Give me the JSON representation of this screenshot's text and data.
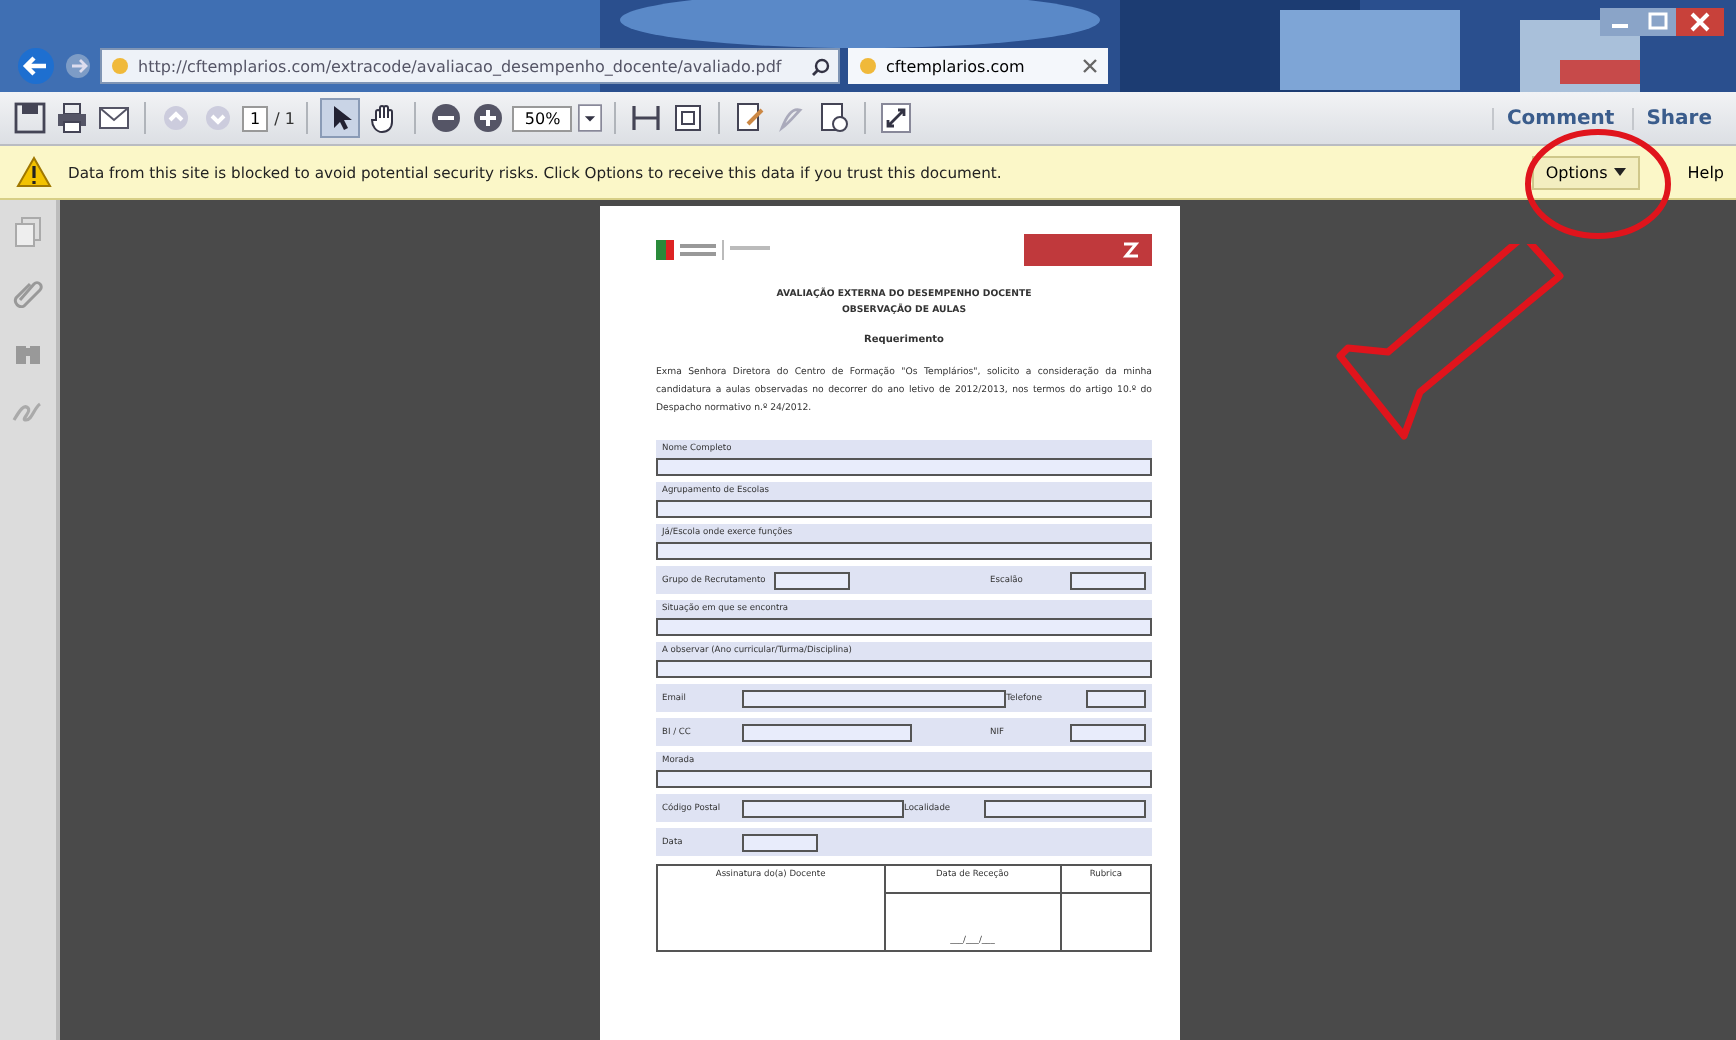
{
  "browser": {
    "address": "http://cftemplarios.com/extracode/avaliacao_desempenho_docente/avaliado.pdf",
    "tabs": [
      {
        "label": "cftemplarios.com",
        "selected": true
      }
    ]
  },
  "toolbar": {
    "page": "1",
    "page_total": "/ 1",
    "zoom": "50%",
    "actions": [
      "Comment",
      "Share"
    ]
  },
  "notice": {
    "message": "Data from this site is blocked to avoid potential security risks. Click Options to receive this data if you trust this document.",
    "options": "Options",
    "help": "Help"
  },
  "document": {
    "title": "AVALIAÇÃO EXTERNA DO DESEMPENHO DOCENTE",
    "subtitle": "OBSERVAÇÃO DE AULAS",
    "heading": "Requerimento",
    "intro": "Exma Senhora Diretora do Centro de Formação \"Os Templários\", solicito a consideração da minha candidatura a aulas observadas no decorrer do ano letivo de 2012/2013, nos termos do artigo 10.º do Despacho normativo n.º 24/2012.",
    "rows": [
      {
        "kind": "wide",
        "label": "Nome Completo"
      },
      {
        "kind": "wide",
        "label": "Agrupamento de Escolas"
      },
      {
        "kind": "wide",
        "label": "Já/Escola onde exerce funções"
      },
      {
        "kind": "inline",
        "fields": [
          {
            "label": "Grupo de Recrutamento",
            "kind": "short"
          },
          {
            "label": "Escalão",
            "kind": "short"
          }
        ]
      },
      {
        "kind": "wide",
        "label": "Situação em que se encontra"
      },
      {
        "kind": "wide",
        "label": "A observar (Ano curricular/Turma/Disciplina)"
      },
      {
        "kind": "inline",
        "fields": [
          {
            "label": "Email",
            "kind": "long"
          },
          {
            "label": "Telefone",
            "kind": "short"
          }
        ]
      },
      {
        "kind": "inline",
        "fields": [
          {
            "label": "BI / CC",
            "kind": "medium"
          },
          {
            "label": "NIF",
            "kind": "short"
          }
        ]
      },
      {
        "kind": "wide",
        "label": "Morada"
      },
      {
        "kind": "inline",
        "fields": [
          {
            "label": "Código Postal",
            "kind": "medium"
          },
          {
            "label": "Localidade",
            "kind": "medium"
          }
        ]
      },
      {
        "kind": "inline",
        "fields": [
          {
            "label": "Data",
            "kind": "short"
          }
        ]
      }
    ],
    "signature": {
      "columns": [
        "Assinatura do(a) Docente",
        "Data de Receção",
        "Rubrica"
      ],
      "date_blank": "___/___/___"
    }
  }
}
